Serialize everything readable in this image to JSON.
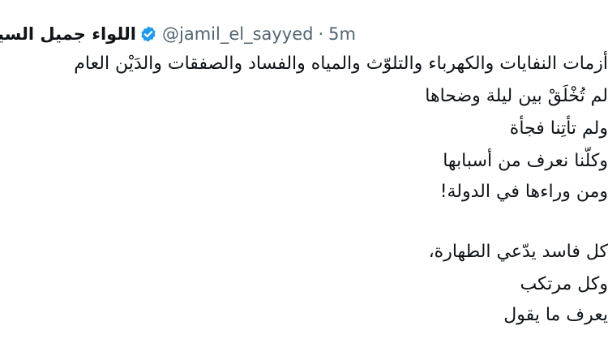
{
  "tweet": {
    "author_name": "اللواء جميل السيد",
    "handle": "@jamil_el_sayyed",
    "separator": "·",
    "time": "5m",
    "lines": [
      "أزمات النفايات والكهرباء والتلوّث والمياه والفساد والصفقات والدَيْن العام",
      "لم تُخْلَقْ بين ليلة وضحاها",
      "ولم تأتِنا فجأة",
      "وكلّنا نعرف من أسبابها",
      "ومن وراءها في الدولة!",
      "",
      "كل فاسد يدّعي الطهارة،",
      "وكل مرتكب",
      "يعرف ما يقول"
    ]
  }
}
